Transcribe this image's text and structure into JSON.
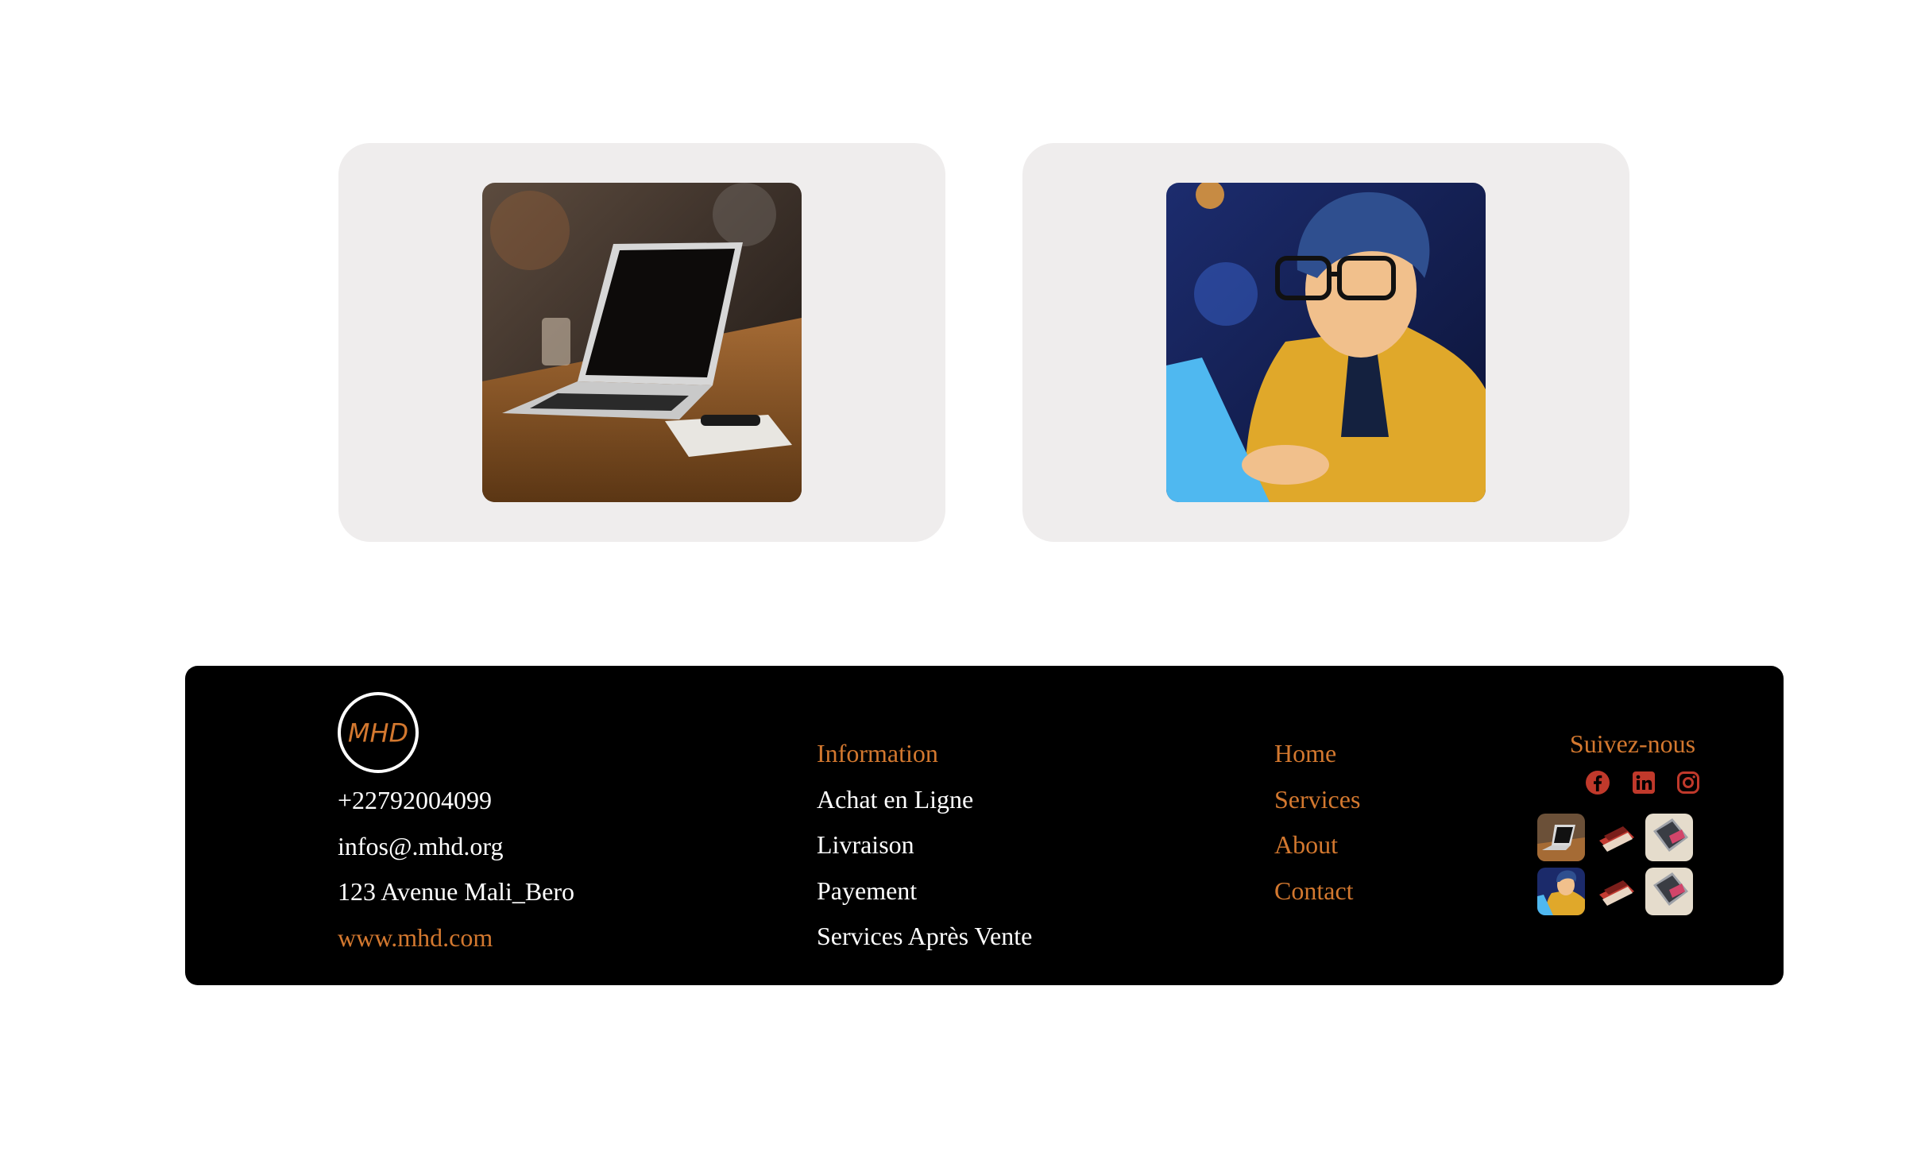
{
  "cards": [
    {
      "image": "laptop-on-wooden-table-photo"
    },
    {
      "image": "child-with-glasses-using-laptop-illustration"
    }
  ],
  "footer": {
    "logo_text": "MHD",
    "contact": {
      "phone": "+22792004099",
      "email": "infos@.mhd.org",
      "address": "123 Avenue Mali_Bero",
      "website": "www.mhd.com"
    },
    "information": {
      "heading": "Information",
      "items": [
        "Achat en Ligne",
        "Livraison",
        "Payement",
        "Services Après Vente"
      ]
    },
    "nav": {
      "items": [
        "Home",
        "Services",
        "About",
        "Contact"
      ]
    },
    "social": {
      "heading": "Suivez-nous",
      "icons": [
        "facebook-icon",
        "linkedin-icon",
        "instagram-icon"
      ],
      "color": "#c0392b"
    },
    "gallery": [
      "laptop-thumbnail",
      "red-laptop-thumbnail",
      "silver-laptop-thumbnail",
      "child-coder-thumbnail",
      "red-laptop-thumbnail",
      "silver-laptop-thumbnail"
    ]
  },
  "colors": {
    "accent": "#d3782f",
    "card_bg": "#efeded",
    "footer_bg": "#000000"
  }
}
